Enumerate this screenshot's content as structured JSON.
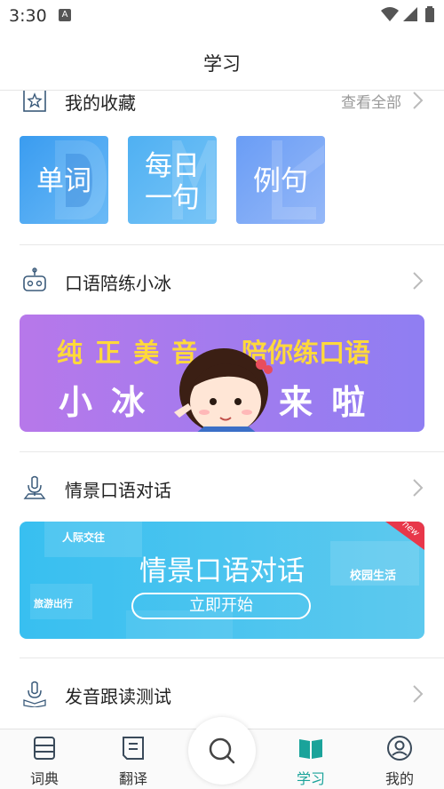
{
  "status_bar": {
    "time": "3:30",
    "notification_badge": "A"
  },
  "header": {
    "title": "学习"
  },
  "favorites": {
    "title": "我的收藏",
    "view_all": "查看全部",
    "cards": [
      {
        "label": "单词",
        "color": "#4aa5f0"
      },
      {
        "label": "每日\n一句",
        "color": "#5ab4f4"
      },
      {
        "label": "例句",
        "color": "#7aa6f6"
      }
    ]
  },
  "oral_practice": {
    "title": "口语陪练小冰",
    "banner": {
      "line1": "纯 正 美 音",
      "line1b": "陪你练口语",
      "line2a": "小 冰",
      "line2b": "来 啦"
    }
  },
  "scenario_dialogue": {
    "title": "情景口语对话",
    "banner": {
      "main": "情景口语对话",
      "button": "立即开始",
      "tag_social": "人际交往",
      "tag_travel": "旅游出行",
      "tag_campus": "校园生活",
      "corner": "new"
    }
  },
  "pronunciation": {
    "title": "发音跟读测试"
  },
  "bottom_nav": {
    "items": [
      {
        "label": "词典",
        "icon": "dictionary-icon"
      },
      {
        "label": "翻译",
        "icon": "translate-icon"
      },
      {
        "label": "学习",
        "icon": "study-book-icon",
        "active": true
      },
      {
        "label": "我的",
        "icon": "profile-icon"
      }
    ],
    "search_icon": "search-icon",
    "active_color": "#1aa39a"
  }
}
